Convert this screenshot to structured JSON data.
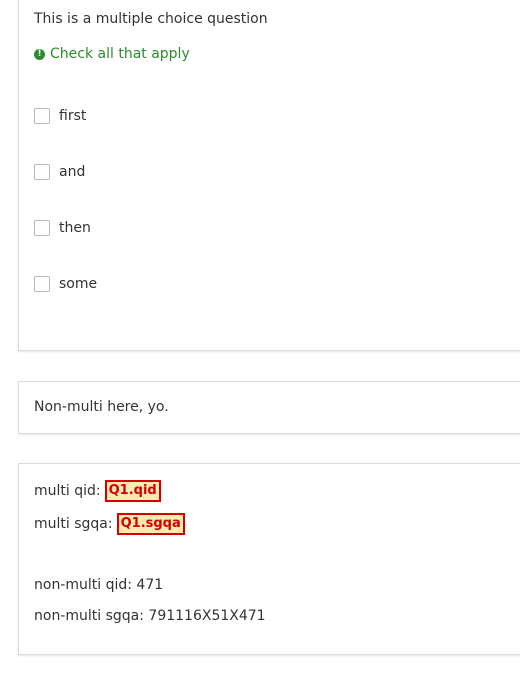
{
  "question": {
    "text": "This is a multiple choice question",
    "help_text": "Check all that apply",
    "help_icon": "exclamation-circle-icon",
    "help_color": "#2e8b2e",
    "options": [
      {
        "label": "first",
        "checked": false
      },
      {
        "label": "and",
        "checked": false
      },
      {
        "label": "then",
        "checked": false
      },
      {
        "label": "some",
        "checked": false
      }
    ]
  },
  "non_multi_panel": {
    "text": "Non-multi here, yo."
  },
  "info_panel": {
    "multi_qid_label": "multi qid:",
    "multi_qid_value": "Q1.qid",
    "multi_sgqa_label": "multi sgqa:",
    "multi_sgqa_value": "Q1.sgqa",
    "non_multi_qid": "non-multi qid: 471",
    "non_multi_sgqa": "non-multi sgqa: 791116X51X471",
    "error_color": "#d40000",
    "error_bg": "#fcebb0"
  }
}
